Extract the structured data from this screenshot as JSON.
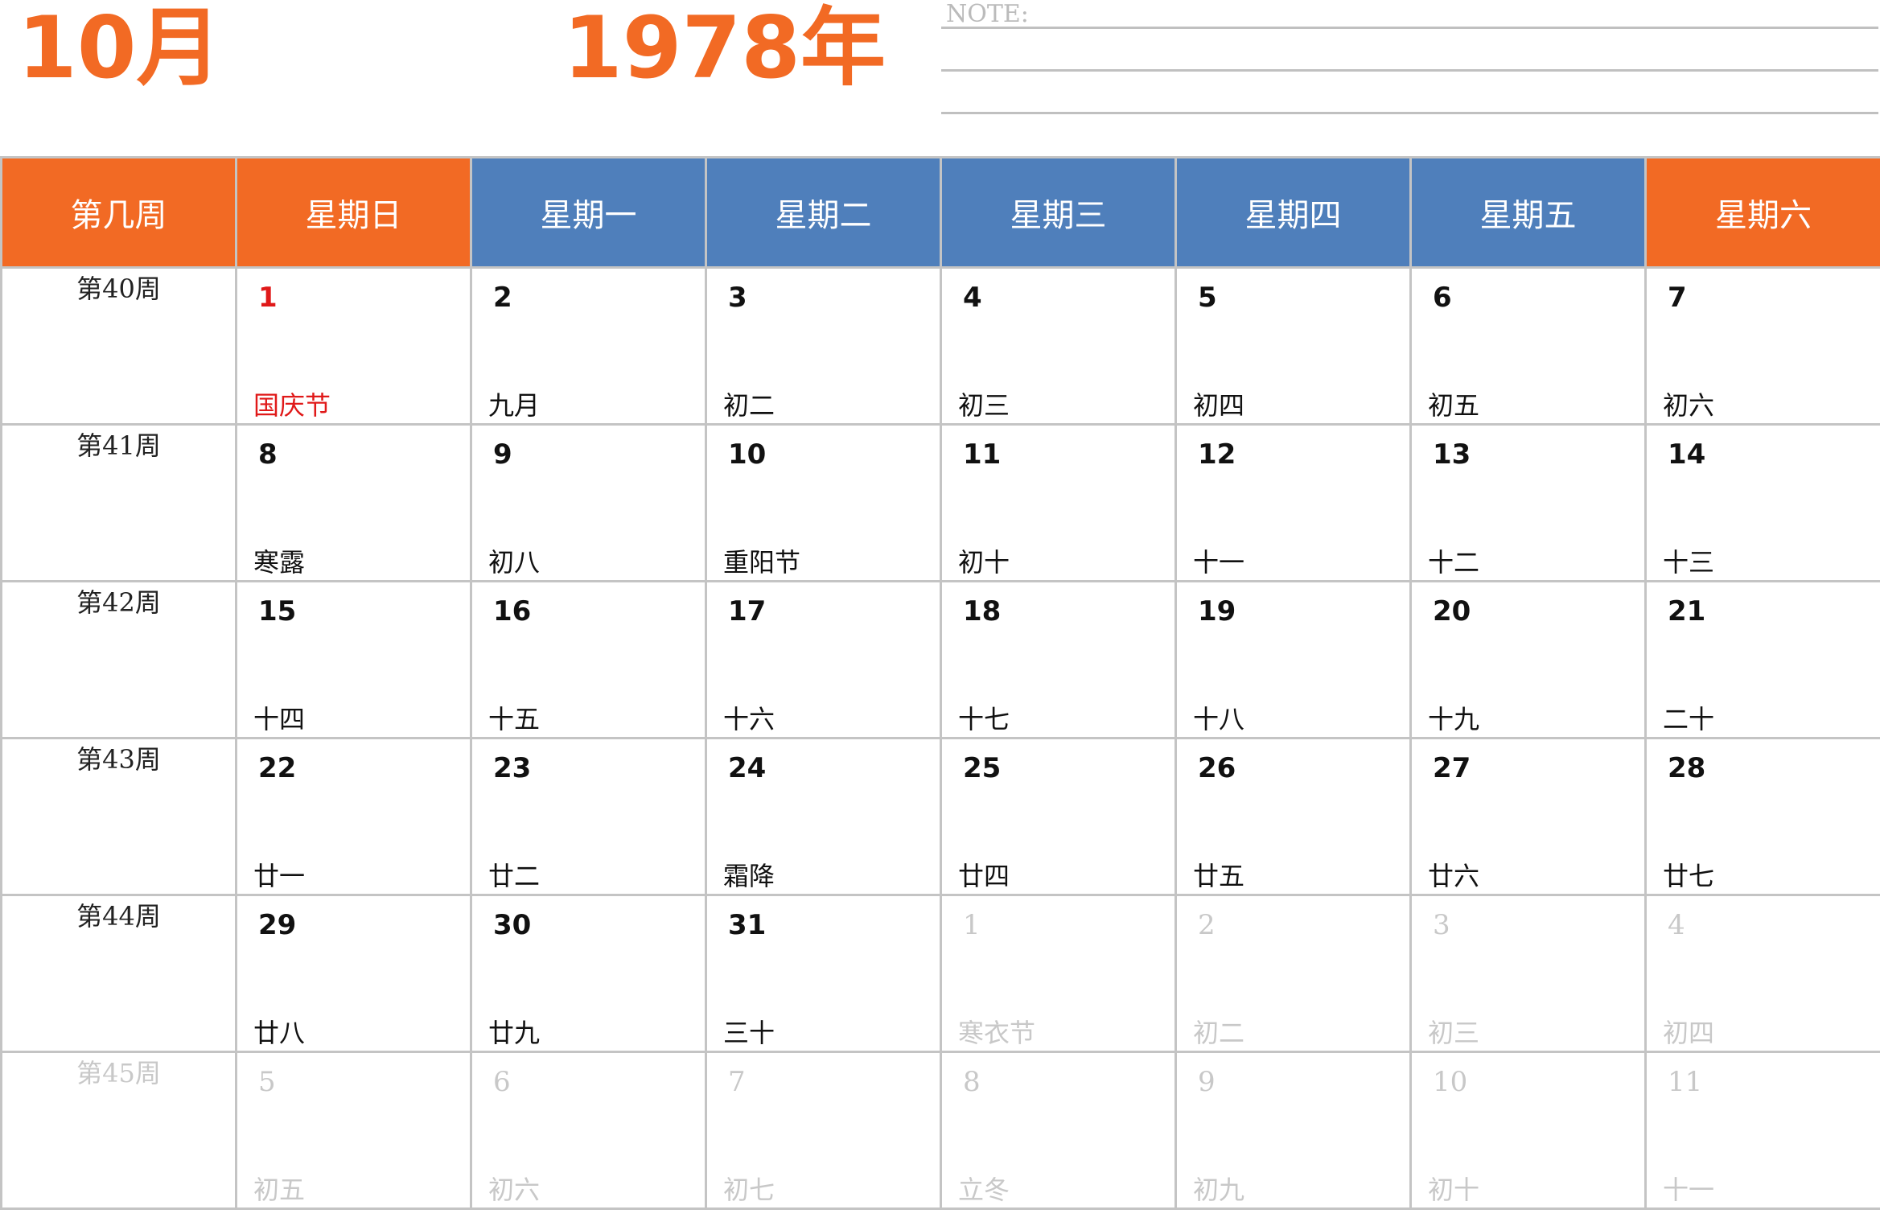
{
  "header": {
    "month": "10月",
    "year": "1978年",
    "note_label": "NOTE:"
  },
  "columns": [
    "第几周",
    "星期日",
    "星期一",
    "星期二",
    "星期三",
    "星期四",
    "星期五",
    "星期六"
  ],
  "weeks": [
    {
      "label": "第40周",
      "faded": false,
      "days": [
        {
          "day": "1",
          "lunar": "国庆节",
          "holiday": true,
          "faded": false
        },
        {
          "day": "2",
          "lunar": "九月",
          "holiday": false,
          "faded": false
        },
        {
          "day": "3",
          "lunar": "初二",
          "holiday": false,
          "faded": false
        },
        {
          "day": "4",
          "lunar": "初三",
          "holiday": false,
          "faded": false
        },
        {
          "day": "5",
          "lunar": "初四",
          "holiday": false,
          "faded": false
        },
        {
          "day": "6",
          "lunar": "初五",
          "holiday": false,
          "faded": false
        },
        {
          "day": "7",
          "lunar": "初六",
          "holiday": false,
          "faded": false
        }
      ]
    },
    {
      "label": "第41周",
      "faded": false,
      "days": [
        {
          "day": "8",
          "lunar": "寒露",
          "holiday": false,
          "faded": false
        },
        {
          "day": "9",
          "lunar": "初八",
          "holiday": false,
          "faded": false
        },
        {
          "day": "10",
          "lunar": "重阳节",
          "holiday": false,
          "faded": false
        },
        {
          "day": "11",
          "lunar": "初十",
          "holiday": false,
          "faded": false
        },
        {
          "day": "12",
          "lunar": "十一",
          "holiday": false,
          "faded": false
        },
        {
          "day": "13",
          "lunar": "十二",
          "holiday": false,
          "faded": false
        },
        {
          "day": "14",
          "lunar": "十三",
          "holiday": false,
          "faded": false
        }
      ]
    },
    {
      "label": "第42周",
      "faded": false,
      "days": [
        {
          "day": "15",
          "lunar": "十四",
          "holiday": false,
          "faded": false
        },
        {
          "day": "16",
          "lunar": "十五",
          "holiday": false,
          "faded": false
        },
        {
          "day": "17",
          "lunar": "十六",
          "holiday": false,
          "faded": false
        },
        {
          "day": "18",
          "lunar": "十七",
          "holiday": false,
          "faded": false
        },
        {
          "day": "19",
          "lunar": "十八",
          "holiday": false,
          "faded": false
        },
        {
          "day": "20",
          "lunar": "十九",
          "holiday": false,
          "faded": false
        },
        {
          "day": "21",
          "lunar": "二十",
          "holiday": false,
          "faded": false
        }
      ]
    },
    {
      "label": "第43周",
      "faded": false,
      "days": [
        {
          "day": "22",
          "lunar": "廿一",
          "holiday": false,
          "faded": false
        },
        {
          "day": "23",
          "lunar": "廿二",
          "holiday": false,
          "faded": false
        },
        {
          "day": "24",
          "lunar": "霜降",
          "holiday": false,
          "faded": false
        },
        {
          "day": "25",
          "lunar": "廿四",
          "holiday": false,
          "faded": false
        },
        {
          "day": "26",
          "lunar": "廿五",
          "holiday": false,
          "faded": false
        },
        {
          "day": "27",
          "lunar": "廿六",
          "holiday": false,
          "faded": false
        },
        {
          "day": "28",
          "lunar": "廿七",
          "holiday": false,
          "faded": false
        }
      ]
    },
    {
      "label": "第44周",
      "faded": false,
      "days": [
        {
          "day": "29",
          "lunar": "廿八",
          "holiday": false,
          "faded": false
        },
        {
          "day": "30",
          "lunar": "廿九",
          "holiday": false,
          "faded": false
        },
        {
          "day": "31",
          "lunar": "三十",
          "holiday": false,
          "faded": false
        },
        {
          "day": "1",
          "lunar": "寒衣节",
          "holiday": false,
          "faded": true
        },
        {
          "day": "2",
          "lunar": "初二",
          "holiday": false,
          "faded": true
        },
        {
          "day": "3",
          "lunar": "初三",
          "holiday": false,
          "faded": true
        },
        {
          "day": "4",
          "lunar": "初四",
          "holiday": false,
          "faded": true
        }
      ]
    },
    {
      "label": "第45周",
      "faded": true,
      "days": [
        {
          "day": "5",
          "lunar": "初五",
          "holiday": false,
          "faded": true
        },
        {
          "day": "6",
          "lunar": "初六",
          "holiday": false,
          "faded": true
        },
        {
          "day": "7",
          "lunar": "初七",
          "holiday": false,
          "faded": true
        },
        {
          "day": "8",
          "lunar": "立冬",
          "holiday": false,
          "faded": true
        },
        {
          "day": "9",
          "lunar": "初九",
          "holiday": false,
          "faded": true
        },
        {
          "day": "10",
          "lunar": "初十",
          "holiday": false,
          "faded": true
        },
        {
          "day": "11",
          "lunar": "十一",
          "holiday": false,
          "faded": true
        }
      ]
    }
  ],
  "colors": {
    "accent_orange": "#f26a24",
    "header_blue": "#4f7fbb",
    "holiday_red": "#e01919",
    "faded_gray": "#c8c8c8",
    "grid_gray": "#c4c4c4"
  }
}
